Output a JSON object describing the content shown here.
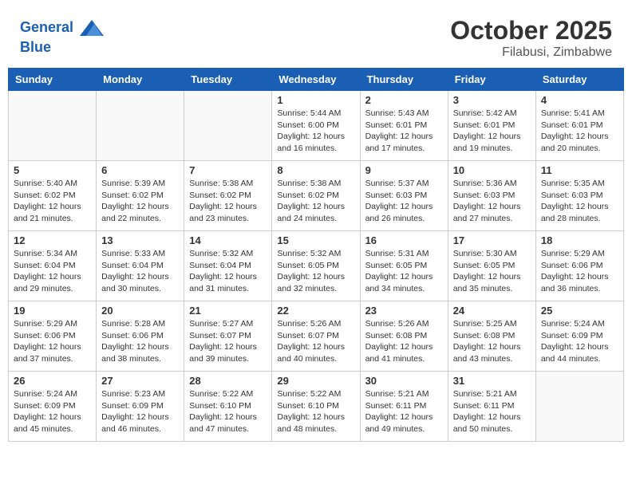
{
  "header": {
    "logo_line1": "General",
    "logo_line2": "Blue",
    "month": "October 2025",
    "location": "Filabusi, Zimbabwe"
  },
  "weekdays": [
    "Sunday",
    "Monday",
    "Tuesday",
    "Wednesday",
    "Thursday",
    "Friday",
    "Saturday"
  ],
  "weeks": [
    [
      {
        "day": "",
        "info": ""
      },
      {
        "day": "",
        "info": ""
      },
      {
        "day": "",
        "info": ""
      },
      {
        "day": "1",
        "info": "Sunrise: 5:44 AM\nSunset: 6:00 PM\nDaylight: 12 hours\nand 16 minutes."
      },
      {
        "day": "2",
        "info": "Sunrise: 5:43 AM\nSunset: 6:01 PM\nDaylight: 12 hours\nand 17 minutes."
      },
      {
        "day": "3",
        "info": "Sunrise: 5:42 AM\nSunset: 6:01 PM\nDaylight: 12 hours\nand 19 minutes."
      },
      {
        "day": "4",
        "info": "Sunrise: 5:41 AM\nSunset: 6:01 PM\nDaylight: 12 hours\nand 20 minutes."
      }
    ],
    [
      {
        "day": "5",
        "info": "Sunrise: 5:40 AM\nSunset: 6:02 PM\nDaylight: 12 hours\nand 21 minutes."
      },
      {
        "day": "6",
        "info": "Sunrise: 5:39 AM\nSunset: 6:02 PM\nDaylight: 12 hours\nand 22 minutes."
      },
      {
        "day": "7",
        "info": "Sunrise: 5:38 AM\nSunset: 6:02 PM\nDaylight: 12 hours\nand 23 minutes."
      },
      {
        "day": "8",
        "info": "Sunrise: 5:38 AM\nSunset: 6:02 PM\nDaylight: 12 hours\nand 24 minutes."
      },
      {
        "day": "9",
        "info": "Sunrise: 5:37 AM\nSunset: 6:03 PM\nDaylight: 12 hours\nand 26 minutes."
      },
      {
        "day": "10",
        "info": "Sunrise: 5:36 AM\nSunset: 6:03 PM\nDaylight: 12 hours\nand 27 minutes."
      },
      {
        "day": "11",
        "info": "Sunrise: 5:35 AM\nSunset: 6:03 PM\nDaylight: 12 hours\nand 28 minutes."
      }
    ],
    [
      {
        "day": "12",
        "info": "Sunrise: 5:34 AM\nSunset: 6:04 PM\nDaylight: 12 hours\nand 29 minutes."
      },
      {
        "day": "13",
        "info": "Sunrise: 5:33 AM\nSunset: 6:04 PM\nDaylight: 12 hours\nand 30 minutes."
      },
      {
        "day": "14",
        "info": "Sunrise: 5:32 AM\nSunset: 6:04 PM\nDaylight: 12 hours\nand 31 minutes."
      },
      {
        "day": "15",
        "info": "Sunrise: 5:32 AM\nSunset: 6:05 PM\nDaylight: 12 hours\nand 32 minutes."
      },
      {
        "day": "16",
        "info": "Sunrise: 5:31 AM\nSunset: 6:05 PM\nDaylight: 12 hours\nand 34 minutes."
      },
      {
        "day": "17",
        "info": "Sunrise: 5:30 AM\nSunset: 6:05 PM\nDaylight: 12 hours\nand 35 minutes."
      },
      {
        "day": "18",
        "info": "Sunrise: 5:29 AM\nSunset: 6:06 PM\nDaylight: 12 hours\nand 36 minutes."
      }
    ],
    [
      {
        "day": "19",
        "info": "Sunrise: 5:29 AM\nSunset: 6:06 PM\nDaylight: 12 hours\nand 37 minutes."
      },
      {
        "day": "20",
        "info": "Sunrise: 5:28 AM\nSunset: 6:06 PM\nDaylight: 12 hours\nand 38 minutes."
      },
      {
        "day": "21",
        "info": "Sunrise: 5:27 AM\nSunset: 6:07 PM\nDaylight: 12 hours\nand 39 minutes."
      },
      {
        "day": "22",
        "info": "Sunrise: 5:26 AM\nSunset: 6:07 PM\nDaylight: 12 hours\nand 40 minutes."
      },
      {
        "day": "23",
        "info": "Sunrise: 5:26 AM\nSunset: 6:08 PM\nDaylight: 12 hours\nand 41 minutes."
      },
      {
        "day": "24",
        "info": "Sunrise: 5:25 AM\nSunset: 6:08 PM\nDaylight: 12 hours\nand 43 minutes."
      },
      {
        "day": "25",
        "info": "Sunrise: 5:24 AM\nSunset: 6:09 PM\nDaylight: 12 hours\nand 44 minutes."
      }
    ],
    [
      {
        "day": "26",
        "info": "Sunrise: 5:24 AM\nSunset: 6:09 PM\nDaylight: 12 hours\nand 45 minutes."
      },
      {
        "day": "27",
        "info": "Sunrise: 5:23 AM\nSunset: 6:09 PM\nDaylight: 12 hours\nand 46 minutes."
      },
      {
        "day": "28",
        "info": "Sunrise: 5:22 AM\nSunset: 6:10 PM\nDaylight: 12 hours\nand 47 minutes."
      },
      {
        "day": "29",
        "info": "Sunrise: 5:22 AM\nSunset: 6:10 PM\nDaylight: 12 hours\nand 48 minutes."
      },
      {
        "day": "30",
        "info": "Sunrise: 5:21 AM\nSunset: 6:11 PM\nDaylight: 12 hours\nand 49 minutes."
      },
      {
        "day": "31",
        "info": "Sunrise: 5:21 AM\nSunset: 6:11 PM\nDaylight: 12 hours\nand 50 minutes."
      },
      {
        "day": "",
        "info": ""
      }
    ]
  ]
}
